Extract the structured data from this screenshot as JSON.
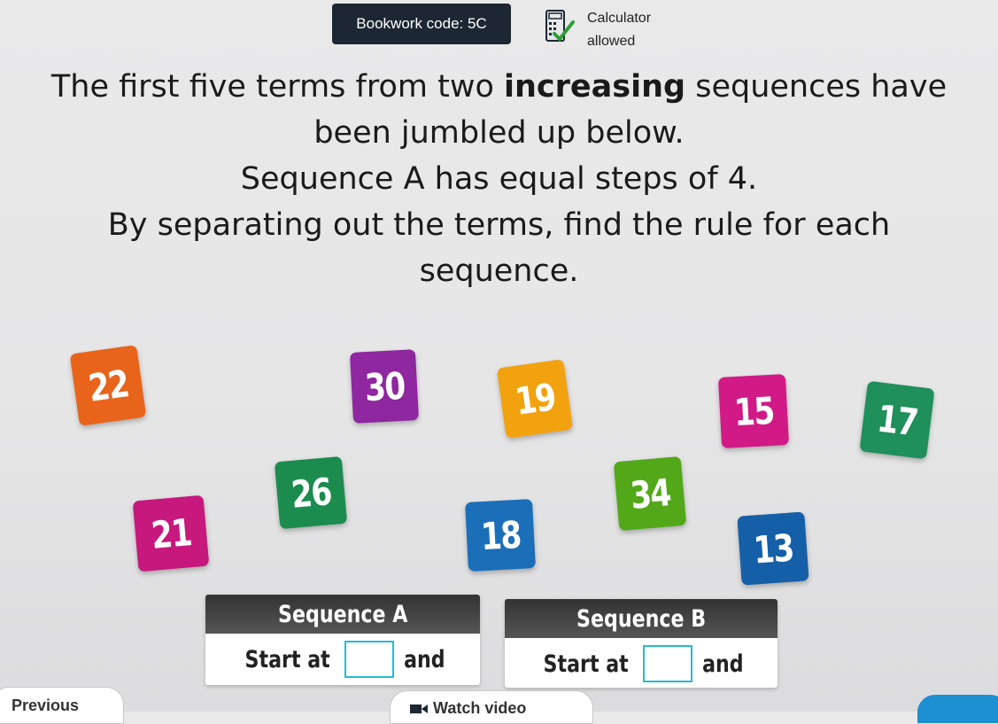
{
  "header": {
    "bookwork_code": "Bookwork code: 5C",
    "calculator_line1": "Calculator",
    "calculator_line2": "allowed",
    "colors": {
      "badge_bg": "#1d2733",
      "check": "#2e9e3a"
    }
  },
  "question": {
    "line1_pre": "The first five terms from two ",
    "line1_bold": "increasing",
    "line1_post": " sequences have",
    "line2": "been jumbled up below.",
    "line3": "Sequence A has equal steps of 4.",
    "line4": "By separating out the terms, find the rule for each",
    "line5": "sequence."
  },
  "tiles": [
    {
      "value": "22",
      "color": "#e8641b"
    },
    {
      "value": "30",
      "color": "#8e27a0"
    },
    {
      "value": "19",
      "color": "#f2a20f"
    },
    {
      "value": "15",
      "color": "#d11a86"
    },
    {
      "value": "17",
      "color": "#1f8f5b"
    },
    {
      "value": "26",
      "color": "#1b8c4e"
    },
    {
      "value": "34",
      "color": "#52a818"
    },
    {
      "value": "21",
      "color": "#c7187d"
    },
    {
      "value": "18",
      "color": "#1b6fb8"
    },
    {
      "value": "13",
      "color": "#155fa8"
    }
  ],
  "sequence_a": {
    "title": "Sequence A",
    "start_label": "Start at",
    "and_label": "and"
  },
  "sequence_b": {
    "title": "Sequence B",
    "start_label": "Start at",
    "and_label": "and"
  },
  "footer": {
    "previous_label": "Previous",
    "watch_label": "Watch video"
  }
}
